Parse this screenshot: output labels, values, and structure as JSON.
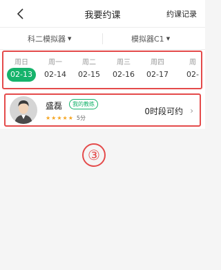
{
  "header": {
    "title": "我要约课",
    "right_link": "约课记录"
  },
  "filters": {
    "subject": "科二模拟器",
    "device": "模拟器C1"
  },
  "days": [
    {
      "weekday": "周日",
      "date": "02-13",
      "active": true
    },
    {
      "weekday": "周一",
      "date": "02-14",
      "active": false
    },
    {
      "weekday": "周二",
      "date": "02-15",
      "active": false
    },
    {
      "weekday": "周三",
      "date": "02-16",
      "active": false
    },
    {
      "weekday": "周四",
      "date": "02-17",
      "active": false
    },
    {
      "weekday": "周",
      "date": "02-",
      "active": false
    }
  ],
  "coach": {
    "name": "盛磊",
    "badge": "我的教练",
    "stars": 5,
    "score": "5分",
    "availability": "0时段可约"
  },
  "annotation": {
    "marker": "③"
  },
  "colors": {
    "accent": "#16b36b",
    "highlight_border": "#e44a4a",
    "star": "#f5a623"
  }
}
